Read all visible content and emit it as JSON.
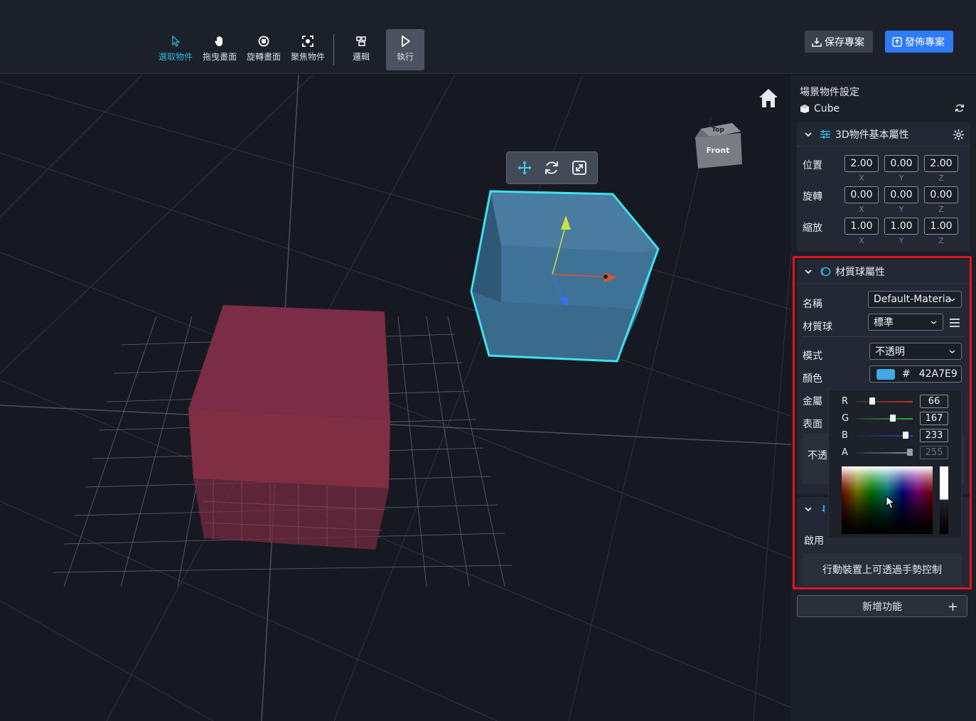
{
  "toolbar": {
    "tools": [
      {
        "label": "選取物件",
        "icon": "cursor-icon",
        "active": true
      },
      {
        "label": "拖曳畫面",
        "icon": "hand-icon",
        "active": false
      },
      {
        "label": "旋轉畫面",
        "icon": "rotate-view-icon",
        "active": false
      },
      {
        "label": "聚焦物件",
        "icon": "focus-icon",
        "active": false
      },
      {
        "label": "邏輯",
        "icon": "logic-icon",
        "active": false
      },
      {
        "label": "執行",
        "icon": "play-icon",
        "active": false
      }
    ],
    "save_label": "保存專案",
    "publish_label": "發佈專案"
  },
  "viewport": {
    "view_cube": {
      "top": "Top",
      "front": "Front"
    },
    "gizmo_tools": [
      "move-icon",
      "rotate-icon",
      "scale-icon"
    ],
    "colors": {
      "selected_cube": "#3f6e93",
      "selection_outline": "#3be3ee",
      "red_cube": "#8c2d4a"
    }
  },
  "panel": {
    "title": "場景物件設定",
    "object_name": "Cube",
    "basic_section": {
      "title": "3D物件基本屬性",
      "rows": [
        {
          "label": "位置",
          "values": [
            "2.00",
            "0.00",
            "2.00"
          ]
        },
        {
          "label": "旋轉",
          "values": [
            "0.00",
            "0.00",
            "0.00"
          ]
        },
        {
          "label": "縮放",
          "values": [
            "1.00",
            "1.00",
            "1.00"
          ]
        }
      ],
      "axes": [
        "X",
        "Y",
        "Z"
      ]
    },
    "material_section": {
      "title": "材質球屬性",
      "name_label": "名稱",
      "name_value": "Default-Materia",
      "material_label": "材質球",
      "material_value": "標準",
      "mode_label": "模式",
      "mode_value": "不透明",
      "color_label": "顏色",
      "color_hash": "#",
      "color_hex": "42A7E9",
      "color_swatch": "#42a7e9",
      "metal_label": "金屬",
      "surface_label": "表面",
      "opacity_label": "不透"
    },
    "picker": {
      "channels": [
        {
          "letter": "R",
          "value": "66",
          "fraction": 0.26,
          "color": "#d7262b"
        },
        {
          "letter": "G",
          "value": "167",
          "fraction": 0.65,
          "color": "#27b23e"
        },
        {
          "letter": "B",
          "value": "233",
          "fraction": 0.91,
          "color": "#2a3cd6"
        },
        {
          "letter": "A",
          "value": "255",
          "fraction": 1.0,
          "color": "#8a8f99"
        }
      ]
    },
    "gesture_section": {
      "enable_label": "啟用",
      "gesture_text": "行動裝置上可透過手勢控制"
    },
    "add_feature_label": "新增功能",
    "add_plus": "+"
  },
  "highlight_color": "#e2141b"
}
